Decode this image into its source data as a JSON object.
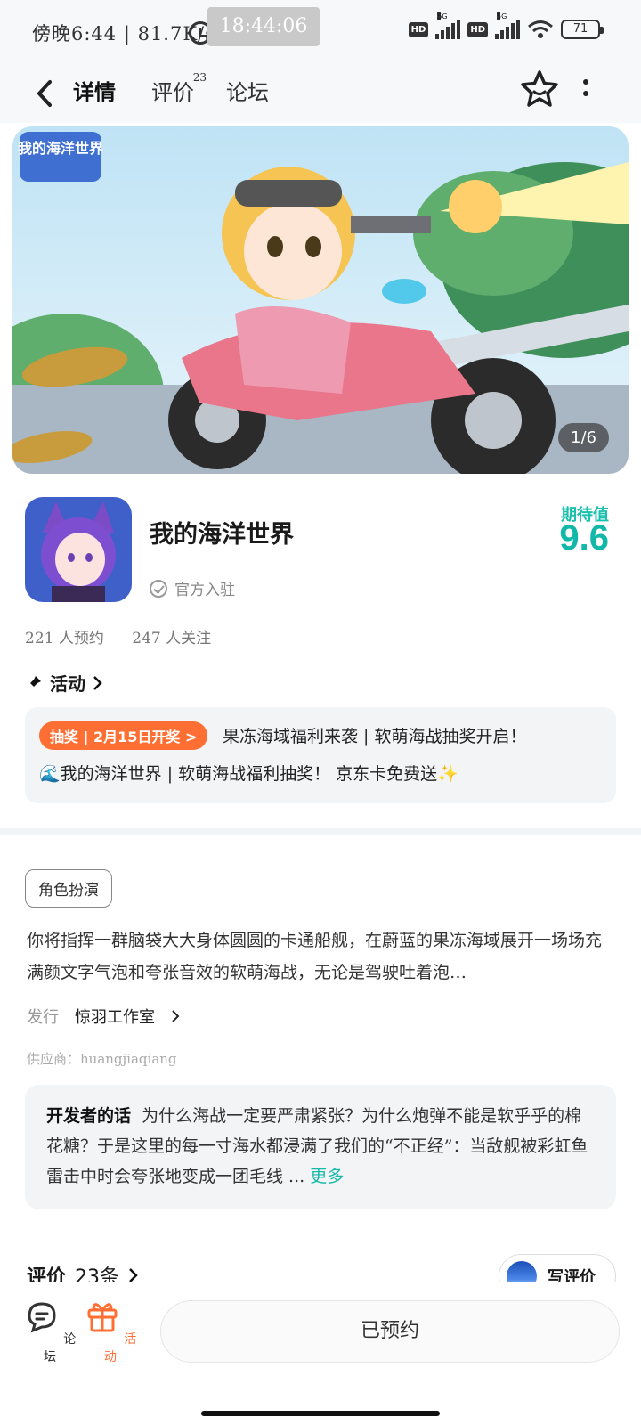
{
  "status_bar": {
    "left_text": "傍晚6:44 | 81.7K/s",
    "clock": "18:44:06",
    "hd1": "HD",
    "hd2": "HD",
    "network1": "5G",
    "network2": "5G",
    "battery": "71"
  },
  "nav": {
    "tabs": [
      {
        "label": "详情",
        "active": true
      },
      {
        "label": "评价",
        "badge": "23"
      },
      {
        "label": "论坛"
      }
    ],
    "icons": [
      "back-icon",
      "star-face-icon",
      "more-vertical-icon"
    ]
  },
  "banner": {
    "logo_text": "我的海洋世界",
    "counter": "1/6"
  },
  "app": {
    "title": "我的海洋世界",
    "verified": "官方入驻",
    "expect_label": "期待值",
    "expect_score": "9.6",
    "reservations": "221 人预约",
    "follows": "247 人关注"
  },
  "activity": {
    "heading": "活动",
    "badge": "抽奖 | 2月15日开奖 >",
    "line1": "果冻海域福利来袭 | 软萌海战抽奖开启！",
    "line2": "🌊我的海洋世界 | 软萌海战福利抽奖！ 京东卡免费送✨"
  },
  "details": {
    "tag": "角色扮演",
    "description": "你将指挥一群脑袋大大身体圆圆的卡通船舰，在蔚蓝的果冻海域展开一场场充满颜文字气泡和夸张音效的软萌海战，无论是驾驶吐着泡…",
    "publisher_key": "发行",
    "publisher_value": "惊羽工作室",
    "supplier": "供应商：huangjiaqiang"
  },
  "developer": {
    "label": "开发者的话",
    "text": "为什么海战一定要严肃紧张？为什么炮弹不能是软乎乎的棉花糖？于是这里的每一寸海水都浸满了我们的“不正经”：当敌舰被彩虹鱼雷击中时会夸张地变成一团毛线 ...",
    "more": "更多"
  },
  "reviews": {
    "label": "评价",
    "count": "23条",
    "write": "写评价"
  },
  "bottom": {
    "forum": "论坛",
    "activity": "活动",
    "reserved": "已预约"
  },
  "colors": {
    "accent": "#19c8b8",
    "orange": "#ff6f33"
  }
}
